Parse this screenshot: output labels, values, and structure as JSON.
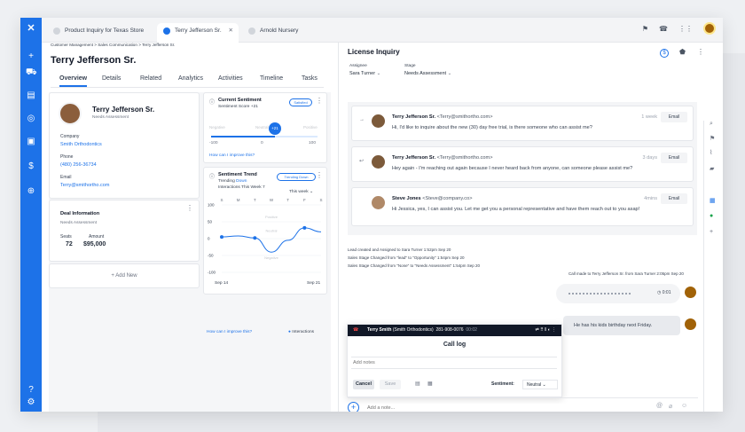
{
  "tabs": [
    {
      "label": "Product Inquiry for Texas Store",
      "active": false
    },
    {
      "label": "Terry Jefferson Sr.",
      "active": true
    },
    {
      "label": "Arnold Nursery",
      "active": false
    }
  ],
  "breadcrumb": "Customer Management > Sales Communication > Terry Jefferson Sr.",
  "page_title": "Terry Jefferson Sr.",
  "subtabs": [
    "Overview",
    "Details",
    "Related",
    "Analytics",
    "Activities",
    "Timeline",
    "Tasks"
  ],
  "contact": {
    "name": "Terry Jefferson Sr.",
    "status": "Needs Assessment",
    "company_label": "Company",
    "company": "Smith Orthodontics",
    "phone_label": "Phone",
    "phone": "(480) 256-36734",
    "email_label": "Email",
    "email": "Terry@smithortho.com"
  },
  "deal": {
    "title": "Deal Information",
    "stage": "Needs Assessment",
    "seats_label": "Seats",
    "seats": "72",
    "amount_label": "Amount",
    "amount": "$95,000"
  },
  "add_new": "+ Add New",
  "sentiment": {
    "title": "Current Sentiment",
    "score": "Sentiment Score +21",
    "badge": "Satisfied",
    "bubble": "+21",
    "neg": "Negative",
    "neu": "Neutral",
    "pos": "Positive",
    "min": "-100",
    "zero": "0",
    "max": "100",
    "link": "How can I improve this?",
    "level": 0.6
  },
  "trend": {
    "title": "Sentiment Trend",
    "trending": "Trending Down",
    "trending_word": "Down",
    "interactions": "Interactions This Week 7",
    "filter": "This week",
    "badge": "Trending Down",
    "days": [
      "S",
      "M",
      "T",
      "W",
      "T",
      "F",
      "S"
    ],
    "yticks": [
      "100",
      "50",
      "0",
      "-50",
      "-100"
    ],
    "bands": [
      "Positive",
      "Neutral",
      "Negative"
    ],
    "start": "Sep 14",
    "end": "Sep 21",
    "link": "How can I improve this?",
    "legend": "Interactions",
    "points": [
      5,
      8,
      2,
      -40,
      -5,
      32,
      20
    ]
  },
  "inquiry": {
    "title": "License Inquiry",
    "assignee_label": "Assignee",
    "assignee": "Sara Turner",
    "stage_label": "Stage",
    "stage": "Needs Assessment"
  },
  "messages": [
    {
      "from": "Terry Jefferson Sr.",
      "addr": "<Terry@smithortho.com>",
      "time": "1 week",
      "btn": "Email",
      "body": "Hi, I'd like to inquire about the new (30) day free trial, is there someone who can assist me?"
    },
    {
      "from": "Terry Jefferson Sr.",
      "addr": "<Terry@smithortho.com>",
      "time": "3 days",
      "btn": "Email",
      "body": "Hey again - I'm reaching out again because I never heard back from anyone, can someone please assist me?"
    },
    {
      "from": "Steve Jones",
      "addr": "<Steve@company.co>",
      "time": "4mins",
      "btn": "Email",
      "body": "Hi Jessica, yes, I can assist you. Let me get you a personal representative and have them reach out to you asap!"
    }
  ],
  "activity": [
    "Lead created and Assigned to Sara Turner 1:52pm Sep 20",
    "Sales Stage Changed from \"lead\" to \"Opportunity\" 1:54pm Sep 20",
    "Sales Stage Changed from \"None\" to \"Needs Assessment\" 1:54pm Sep 20"
  ],
  "call_made": "Call made to Terry Jefferson Sr. from Sara Turner 2:05pm Sep 20",
  "audio_time": "0:01",
  "note_bubble": "He has his kids birthday next Friday.",
  "call": {
    "name": "Terry Smith",
    "company": "(Smith Orthodontics)",
    "number": "281-908-0076",
    "timer": "00:02",
    "title": "Call log",
    "placeholder": "Add notes",
    "cancel": "Cancel",
    "save": "Save",
    "sentiment_label": "Sentiment:",
    "sentiment": "Neutral"
  },
  "note_placeholder": "Add a note..."
}
